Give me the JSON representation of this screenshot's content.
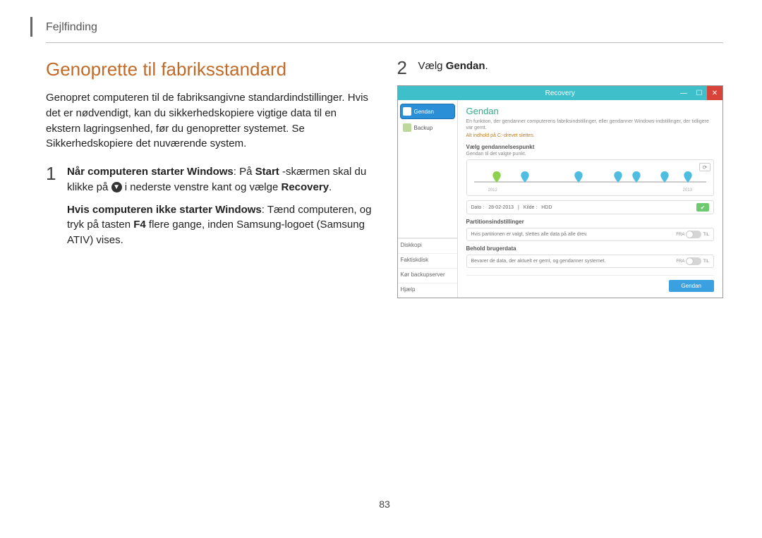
{
  "breadcrumb": "Fejlfinding",
  "heading": "Genoprette til fabriksstandard",
  "intro": "Genopret computeren til de fabriksangivne standardindstillinger. Hvis det er nødvendigt, kan du sikkerhedskopiere vigtige data til en ekstern lagringsenhed, før du genopretter systemet. Se Sikkerhedskopiere det nuværende system.",
  "steps": {
    "s1": {
      "num": "1",
      "line1_a": "Når computeren starter Windows",
      "line1_b": ": På ",
      "line1_c": "Start",
      "line1_d": " -skærmen skal du klikke på ",
      "line1_e": " i nederste venstre kant og vælge ",
      "line1_f": "Recovery",
      "line1_g": ".",
      "line2_a": "Hvis computeren ikke starter Windows",
      "line2_b": ": Tænd computeren, og tryk på tasten ",
      "line2_c": "F4",
      "line2_d": " flere gange, inden Samsung-logoet (Samsung ATIV) vises."
    },
    "s2": {
      "num": "2",
      "text_a": "Vælg ",
      "text_b": "Gendan",
      "text_c": "."
    }
  },
  "recovery": {
    "title": "Recovery",
    "win_min": "—",
    "win_max": "☐",
    "win_close": "✕",
    "sidebar_top": [
      {
        "label": "Gendan",
        "active": true
      },
      {
        "label": "Backup",
        "active": false
      }
    ],
    "sidebar_bottom": [
      "Diskkopi",
      "Faktiskdisk",
      "Kør backupserver",
      "Hjælp"
    ],
    "main_title": "Gendan",
    "main_desc": "En funktion, der gendanner computerens fabriksindstillinger, eller gendanner Windows-indstillinger, der tidligere var gemt.",
    "main_warn": "Alt indhold på C:-drevet slettes.",
    "sect_point_title": "Vælg gendannelsespunkt",
    "sect_point_sub": "Gendan til det valgte punkt.",
    "year_a": "2012",
    "year_b": "2013",
    "status_date_label": "Dato :",
    "status_date": "28-02-2013",
    "status_src_label": "Kilde :",
    "status_src": "HDD",
    "sect_part_title": "Partitionsindstillinger",
    "part_text": "Hvis partitionen er valgt, slettes alle data på alle drev.",
    "sect_keep_title": "Behold brugerdata",
    "keep_text": "Bevarer de data, der aktuelt er gemt, og gendanner systemet.",
    "toggle_off": "FRA",
    "toggle_on": "TIL",
    "action": "Gendan"
  },
  "page_no": "83"
}
